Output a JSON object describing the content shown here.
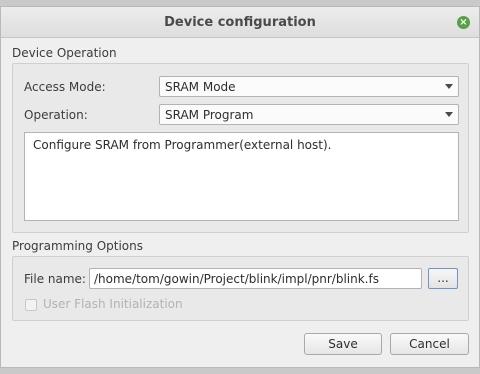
{
  "window": {
    "title": "Device configuration",
    "close_glyph": "×"
  },
  "device_operation": {
    "section_title": "Device Operation",
    "access_mode_label": "Access Mode:",
    "access_mode_value": "SRAM Mode",
    "operation_label": "Operation:",
    "operation_value": "SRAM Program",
    "description": "Configure SRAM from Programmer(external host)."
  },
  "programming_options": {
    "section_title": "Programming Options",
    "file_name_label": "File name:",
    "file_name_value": "/home/tom/gowin/Project/blink/impl/pnr/blink.fs",
    "browse_label": "...",
    "user_flash_label": "User Flash Initialization",
    "user_flash_checked": false
  },
  "buttons": {
    "save": "Save",
    "cancel": "Cancel"
  },
  "colors": {
    "close_icon": "#56a04a",
    "browse_border": "#6f95c8"
  }
}
